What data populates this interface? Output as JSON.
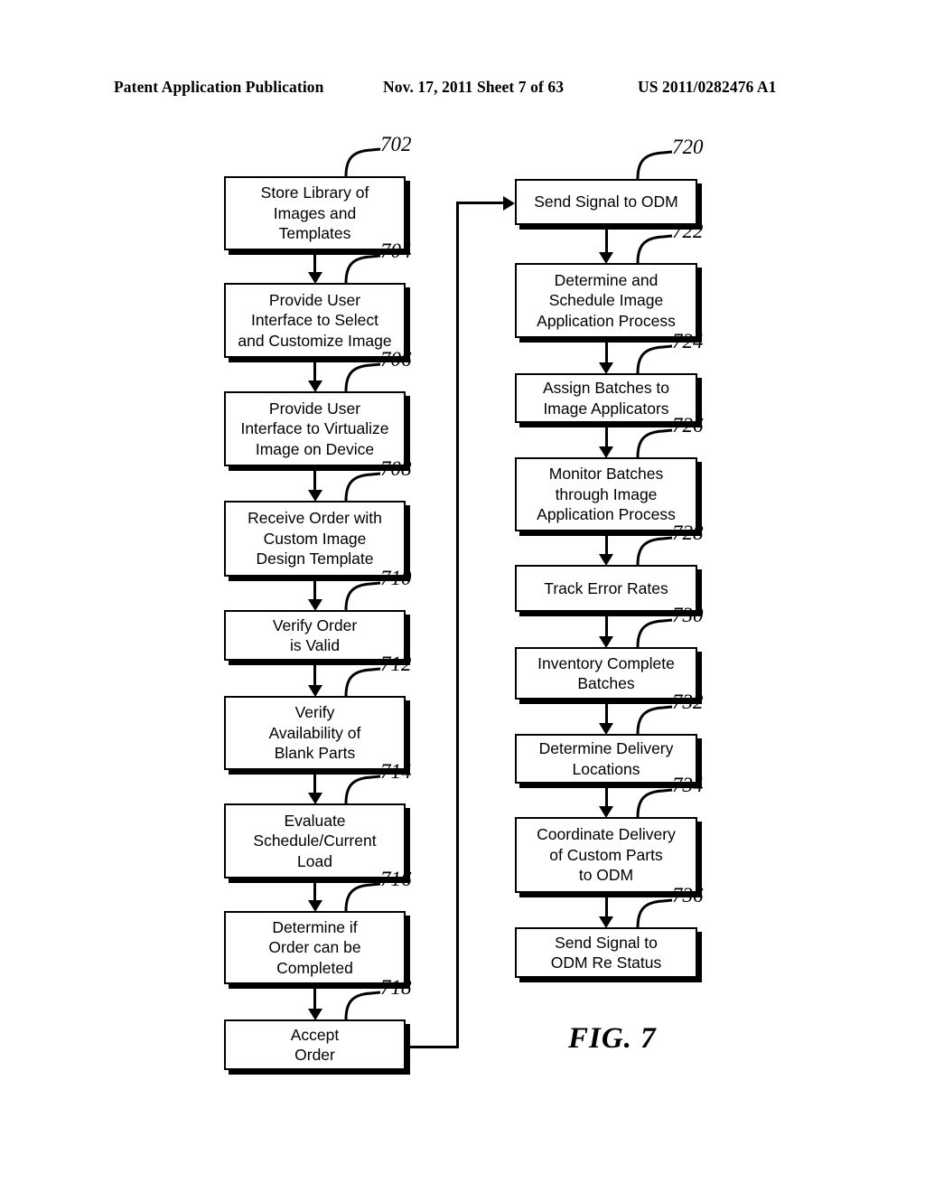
{
  "header": {
    "publication": "Patent Application Publication",
    "date_sheet": "Nov. 17, 2011  Sheet 7 of 63",
    "patent_number": "US 2011/0282476 A1"
  },
  "figure": {
    "caption": "FIG. 7"
  },
  "flowchart": {
    "left_column": [
      {
        "ref": "702",
        "label": "Store Library of\nImages and\nTemplates"
      },
      {
        "ref": "704",
        "label": "Provide User\nInterface to Select\nand Customize Image"
      },
      {
        "ref": "706",
        "label": "Provide User\nInterface to Virtualize\nImage on Device"
      },
      {
        "ref": "708",
        "label": "Receive Order with\nCustom Image\nDesign Template"
      },
      {
        "ref": "710",
        "label": "Verify Order\nis Valid"
      },
      {
        "ref": "712",
        "label": "Verify\nAvailability of\nBlank Parts"
      },
      {
        "ref": "714",
        "label": "Evaluate\nSchedule/Current\nLoad"
      },
      {
        "ref": "716",
        "label": "Determine if\nOrder can be\nCompleted"
      },
      {
        "ref": "718",
        "label": "Accept\nOrder"
      }
    ],
    "right_column": [
      {
        "ref": "720",
        "label": "Send Signal to ODM"
      },
      {
        "ref": "722",
        "label": "Determine and\nSchedule Image\nApplication Process"
      },
      {
        "ref": "724",
        "label": "Assign Batches to\nImage Applicators"
      },
      {
        "ref": "726",
        "label": "Monitor Batches\nthrough Image\nApplication Process"
      },
      {
        "ref": "728",
        "label": "Track Error Rates"
      },
      {
        "ref": "730",
        "label": "Inventory Complete\nBatches"
      },
      {
        "ref": "732",
        "label": "Determine Delivery\nLocations"
      },
      {
        "ref": "734",
        "label": "Coordinate Delivery\nof Custom Parts\nto ODM"
      },
      {
        "ref": "736",
        "label": "Send Signal to\nODM Re Status"
      }
    ]
  }
}
